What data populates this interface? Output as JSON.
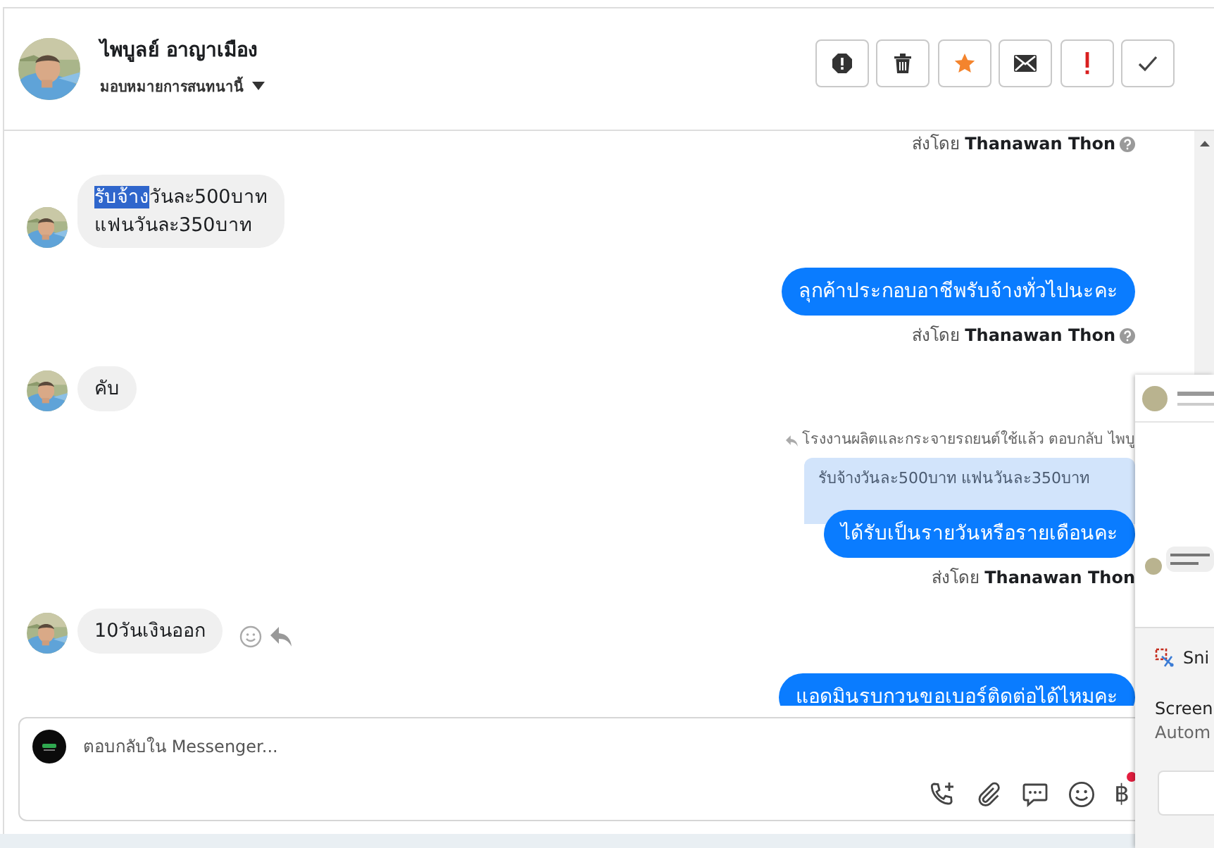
{
  "header": {
    "name": "ไพบูลย์ อาญาเมือง",
    "assign_label": "มอบหมายการสนทนานี้",
    "actions": [
      {
        "kind": "spam"
      },
      {
        "kind": "delete"
      },
      {
        "kind": "star"
      },
      {
        "kind": "unread"
      },
      {
        "kind": "important"
      },
      {
        "kind": "done"
      }
    ]
  },
  "messages": [
    {
      "kind": "meta",
      "text": "ส่งโดย **Thanawan Thon**",
      "help_icon": true
    },
    {
      "kind": "incoming",
      "parts": [
        {
          "text": "รับจ้าง",
          "selected": true
        },
        {
          "text": "วันละ500บาท\nแฟนวันละ350บาท",
          "selected": false
        }
      ],
      "hover_actions": false
    },
    {
      "kind": "outgoing",
      "text": "ลุกค้าประกอบอาชีพรับจ้างทั่วไปนะคะ"
    },
    {
      "kind": "meta",
      "text": "ส่งโดย **Thanawan Thon**",
      "help_icon": true
    },
    {
      "kind": "incoming",
      "parts": [
        {
          "text": "คับ",
          "selected": false
        }
      ],
      "hover_actions": false
    },
    {
      "kind": "reply_context",
      "text": "โรงงานผลิตและกระจายรถยนต์ใช้แล้ว ตอบกลับ ไพบู"
    },
    {
      "kind": "quote",
      "text": "รับจ้างวันละ500บาท แฟนวันละ350บาท"
    },
    {
      "kind": "outgoing",
      "text": "ได้รับเป็นรายวันหรือรายเดือนคะ"
    },
    {
      "kind": "meta",
      "text": "ส่งโดย **Thanawan Thon**",
      "help_icon": false
    },
    {
      "kind": "incoming",
      "parts": [
        {
          "text": "10วันเงินออก",
          "selected": false
        }
      ],
      "hover_actions": true
    },
    {
      "kind": "outgoing",
      "text": "แอดมินรบกวนขอเบอร์ติดต่อได้ไหมคะ"
    }
  ],
  "composer": {
    "placeholder": "ตอบกลับใน Messenger...",
    "tools": [
      {
        "kind": "call"
      },
      {
        "kind": "attach"
      },
      {
        "kind": "saved_reply"
      },
      {
        "kind": "emoji"
      },
      {
        "kind": "payment",
        "text": "฿"
      }
    ]
  },
  "notification": {
    "title": "Sni",
    "line_1": "Screen",
    "line_2": "Autom"
  }
}
